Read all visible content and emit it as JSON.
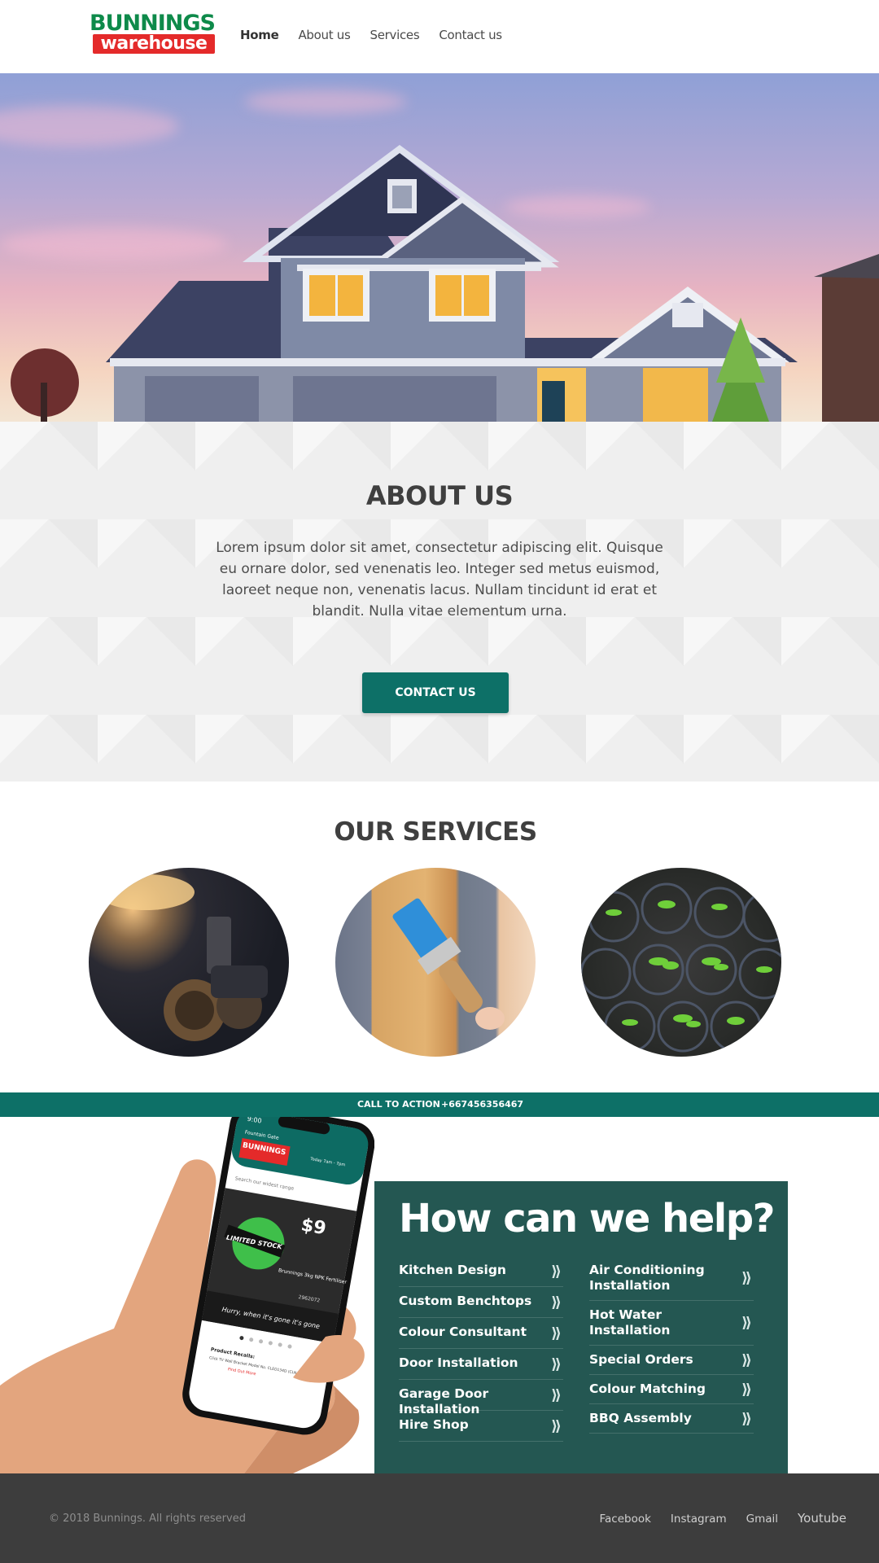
{
  "brand": {
    "logo_top": "BUNNINGS",
    "logo_bottom": "warehouse"
  },
  "nav": [
    {
      "label": "Home",
      "active": true
    },
    {
      "label": "About us"
    },
    {
      "label": "Services"
    },
    {
      "label": "Contact us"
    }
  ],
  "about": {
    "title": "ABOUT US",
    "text": "Lorem ipsum dolor sit amet, consectetur adipiscing elit. Quisque eu ornare dolor, sed venenatis leo. Integer sed metus euismod, laoreet neque non, venenatis lacus. Nullam tincidunt id erat et blandit. Nulla vitae elementum urna.",
    "button": "CONTACT US"
  },
  "services": {
    "title": "OUR SERVICES"
  },
  "cta_bar": {
    "label": "CALL TO ACTION",
    "phone": "+667456356467"
  },
  "phone_screen": {
    "time": "9:00",
    "store": "Fountain Gate",
    "hours": "Today 7am - 7pm",
    "search_placeholder": "Search our widest range",
    "badge": "LIMITED STOCK",
    "price": "$9",
    "product": "Brunnings 3kg NPK Fertiliser",
    "code": "2962072",
    "banner": "Hurry, when it's gone it's gone",
    "recall_label": "Product Recalls:",
    "recall_text": "Click TV Wall Bracket Model No. CLED134D (CLN 7239)",
    "recall_link": "Find Out More"
  },
  "help": {
    "title": "How can we help?",
    "left": [
      "Kitchen Design",
      "Custom Benchtops",
      "Colour Consultant",
      "Door Installation",
      "Garage Door Installation",
      "Hire Shop"
    ],
    "right": [
      "Air Conditioning Installation",
      "Hot Water Installation",
      "Special Orders",
      "Colour Matching",
      "BBQ Assembly"
    ],
    "chevron": "⟫"
  },
  "footer": {
    "copyright": "© 2018 Bunnings. All rights reserved",
    "links": [
      "Facebook",
      "Instagram",
      "Gmail",
      "Youtube"
    ]
  },
  "colors": {
    "teal": "#0d7067",
    "help_panel": "#245752",
    "footer": "#3d3d3d",
    "logo_green": "#0e8a4a",
    "logo_red": "#e42a2a"
  }
}
